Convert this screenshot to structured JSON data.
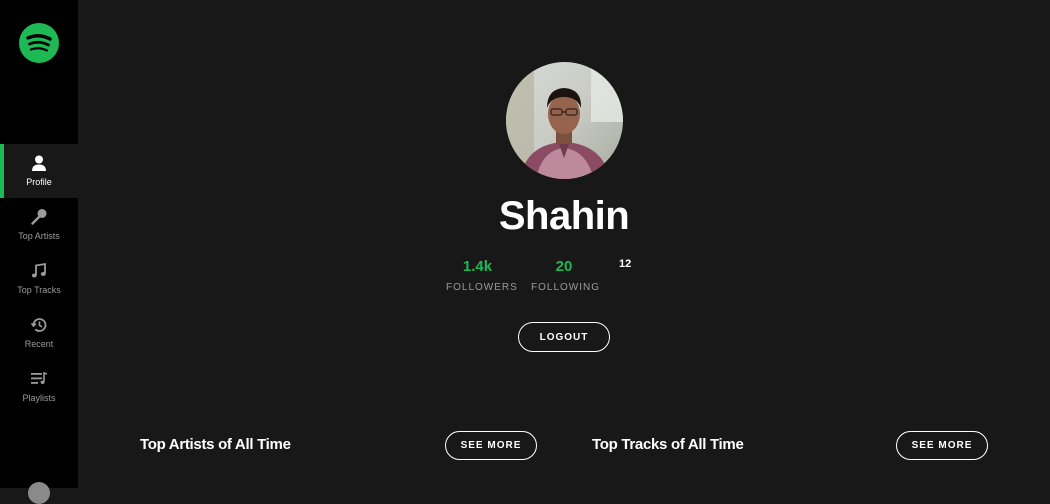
{
  "sidebar": {
    "logo_icon": "spotify-logo-icon",
    "items": [
      {
        "label": "Profile",
        "icon": "user-icon",
        "active": true
      },
      {
        "label": "Top Artists",
        "icon": "microphone-icon",
        "active": false
      },
      {
        "label": "Top Tracks",
        "icon": "music-note-icon",
        "active": false
      },
      {
        "label": "Recent",
        "icon": "history-icon",
        "active": false
      },
      {
        "label": "Playlists",
        "icon": "playlist-icon",
        "active": false
      }
    ]
  },
  "profile": {
    "username": "Shahin",
    "stats": {
      "followers_value": "1.4k",
      "followers_label": "FOLLOWERS",
      "following_value": "20",
      "following_label": "FOLLOWING",
      "extra_value": "12"
    },
    "logout_label": "LOGOUT"
  },
  "sections": {
    "artists_title": "Top Artists of All Time",
    "artists_button": "SEE MORE",
    "tracks_title": "Top Tracks of All Time",
    "tracks_button": "SEE MORE"
  },
  "colors": {
    "accent": "#1db954",
    "background": "#181818",
    "sidebar": "#000000",
    "muted_text": "#9b9b9b"
  }
}
